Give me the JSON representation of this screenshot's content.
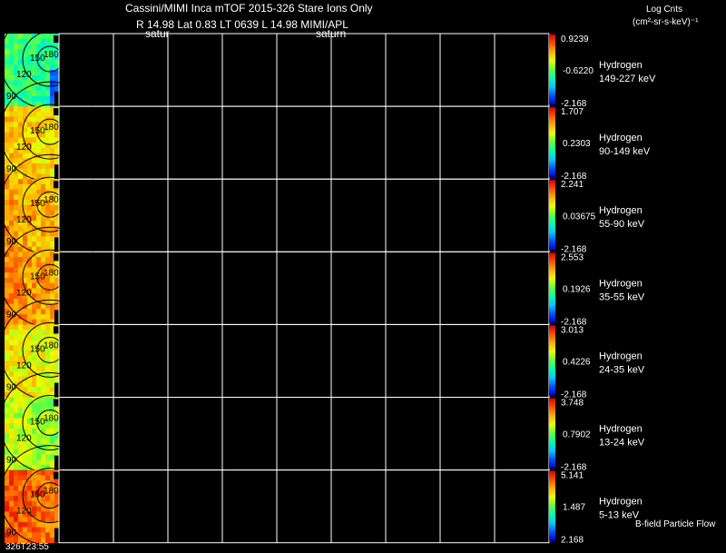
{
  "header": {
    "title": "Cassini/MIMI Inca mTOF  2015-326   Stare   Ions Only",
    "info": "R        14.98 Lat 0.83 LT 0639 L       14.98  MIMI/APL",
    "satur_left": "satur",
    "satur_right": "saturn",
    "units_line1": "Log Cnts",
    "units_line2": "(cm²-sr-s-keV)⁻¹"
  },
  "footer": {
    "timestamp": "326T23:55",
    "note": "B-field  Particle Flow"
  },
  "contour_labels": [
    "150",
    "180",
    "120",
    "90"
  ],
  "colors": {
    "background": "#000000",
    "grid": "#ffffff",
    "colormap": [
      "#0000c8",
      "#0050ff",
      "#00c8ff",
      "#00ffb0",
      "#60ff40",
      "#e8ff00",
      "#ffb000",
      "#ff5000",
      "#d80000"
    ]
  },
  "chart_data": {
    "type": "heatmap",
    "description_rows": 7,
    "grid_columns": 9,
    "panels": [
      {
        "species": "Hydrogen",
        "energy": "149-227 keV",
        "max": "0.9239",
        "mid": "-0.6220",
        "min": "-2.168",
        "level": 0.45
      },
      {
        "species": "Hydrogen",
        "energy": "90-149 keV",
        "max": "1.707",
        "mid": "0.2303",
        "min": "-2.168",
        "level": 0.72
      },
      {
        "species": "Hydrogen",
        "energy": "55-90 keV",
        "max": "2.241",
        "mid": "0.03675",
        "min": "-2.168",
        "level": 0.78
      },
      {
        "species": "Hydrogen",
        "energy": "35-55 keV",
        "max": "2.553",
        "mid": "0.1926",
        "min": "-2.168",
        "level": 0.8
      },
      {
        "species": "Hydrogen",
        "energy": "24-35 keV",
        "max": "3.013",
        "mid": "0.4226",
        "min": "-2.168",
        "level": 0.68
      },
      {
        "species": "Hydrogen",
        "energy": "13-24 keV",
        "max": "3.748",
        "mid": "0.7902",
        "min": "-2.168",
        "level": 0.6
      },
      {
        "species": "Hydrogen",
        "energy": "5-13 keV",
        "max": "5.141",
        "mid": "1.487",
        "min": "2.168",
        "level": 0.88
      }
    ]
  }
}
